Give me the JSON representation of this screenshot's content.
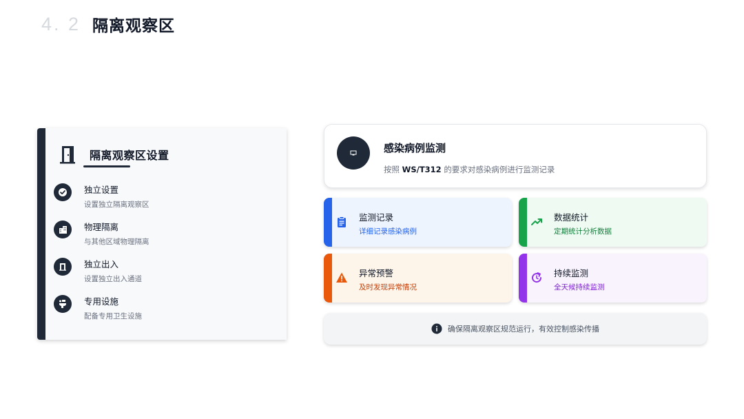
{
  "header": {
    "section_number": "4. 2",
    "title": "隔离观察区"
  },
  "left_panel": {
    "icon": "door-icon",
    "title": "隔离观察区设置",
    "features": [
      {
        "icon": "check-circle-icon",
        "title": "独立设置",
        "subtitle": "设置独立隔离观察区"
      },
      {
        "icon": "building-icon",
        "title": "物理隔离",
        "subtitle": "与其他区域物理隔离"
      },
      {
        "icon": "door-open-icon",
        "title": "独立出入",
        "subtitle": "设置独立出入通道"
      },
      {
        "icon": "toilet-icon",
        "title": "专用设施",
        "subtitle": "配备专用卫生设施"
      }
    ]
  },
  "top_card": {
    "icon": "monitor-icon",
    "title": "感染病例监测",
    "subtitle_prefix": "按照",
    "subtitle_standard": "WS/T312",
    "subtitle_suffix": "的要求对感染病例进行监测记录"
  },
  "cards": [
    {
      "icon": "clipboard-icon",
      "title": "监测记录",
      "subtitle": "详细记录感染病例",
      "accent": "#2563eb",
      "bg": "#eef4fd",
      "text_color": "#2563eb"
    },
    {
      "icon": "trend-up-icon",
      "title": "数据统计",
      "subtitle": "定期统计分析数据",
      "accent": "#16a34a",
      "bg": "#eefaf2",
      "text_color": "#15803d"
    },
    {
      "icon": "warning-icon",
      "title": "异常预警",
      "subtitle": "及时发现异常情况",
      "accent": "#ea580c",
      "bg": "#fdf5ea",
      "text_color": "#c2410c"
    },
    {
      "icon": "refresh-clock-icon",
      "title": "持续监测",
      "subtitle": "全天候持续监测",
      "accent": "#9333ea",
      "bg": "#f8f3fd",
      "text_color": "#7e22ce"
    }
  ],
  "note": {
    "icon": "info-icon",
    "text": "确保隔离观察区规范运行，有效控制感染传播"
  }
}
